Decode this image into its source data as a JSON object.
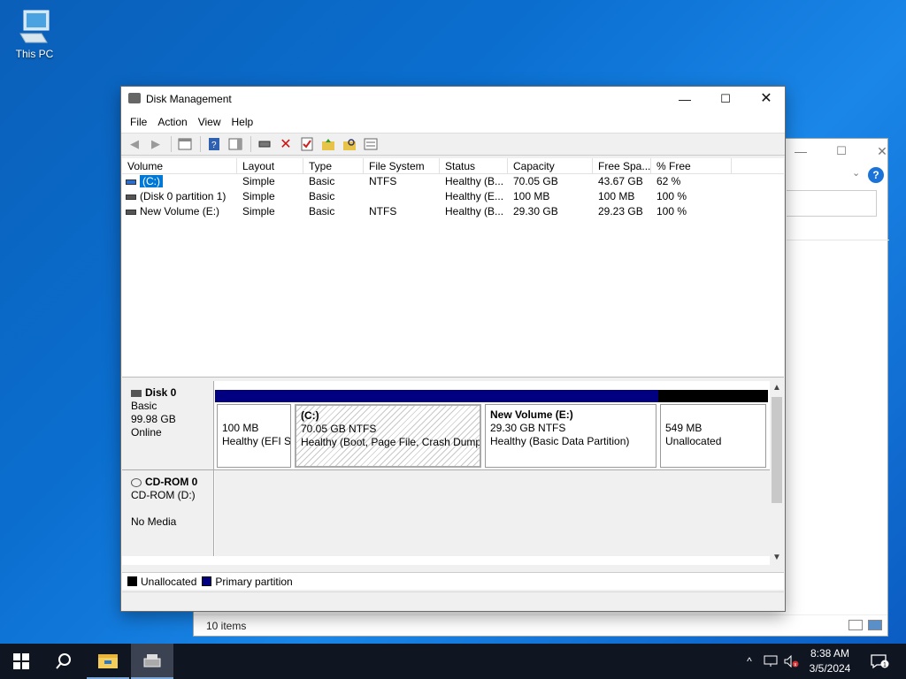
{
  "desktop": {
    "icon_label": "This PC"
  },
  "bg_window": {
    "status_text": "10 items"
  },
  "window": {
    "title": "Disk Management",
    "menu": [
      "File",
      "Action",
      "View",
      "Help"
    ],
    "columns": [
      "Volume",
      "Layout",
      "Type",
      "File System",
      "Status",
      "Capacity",
      "Free Spa...",
      "% Free"
    ],
    "volumes": [
      {
        "volume": "(C:)",
        "layout": "Simple",
        "type": "Basic",
        "fs": "NTFS",
        "status": "Healthy (B...",
        "capacity": "70.05 GB",
        "free": "43.67 GB",
        "pct": "62 %"
      },
      {
        "volume": "(Disk 0 partition 1)",
        "layout": "Simple",
        "type": "Basic",
        "fs": "",
        "status": "Healthy (E...",
        "capacity": "100 MB",
        "free": "100 MB",
        "pct": "100 %"
      },
      {
        "volume": "New Volume (E:)",
        "layout": "Simple",
        "type": "Basic",
        "fs": "NTFS",
        "status": "Healthy (B...",
        "capacity": "29.30 GB",
        "free": "29.23 GB",
        "pct": "100 %"
      }
    ],
    "disk0": {
      "name": "Disk 0",
      "type": "Basic",
      "size": "99.98 GB",
      "state": "Online",
      "partitions": [
        {
          "title": "",
          "line1": "100 MB",
          "line2": "Healthy (EFI S"
        },
        {
          "title": "(C:)",
          "line1": "70.05 GB NTFS",
          "line2": "Healthy (Boot, Page File, Crash Dump,"
        },
        {
          "title": "New Volume  (E:)",
          "line1": "29.30 GB NTFS",
          "line2": "Healthy (Basic Data Partition)"
        },
        {
          "title": "",
          "line1": "549 MB",
          "line2": "Unallocated"
        }
      ]
    },
    "cdrom": {
      "name": "CD-ROM 0",
      "line1": "CD-ROM (D:)",
      "line2": "No Media"
    },
    "legend": {
      "unallocated": "Unallocated",
      "primary": "Primary partition"
    },
    "colors": {
      "primary": "#000080",
      "unallocated": "#000000",
      "selection": "#0078d7"
    }
  },
  "taskbar": {
    "time": "8:38 AM",
    "date": "3/5/2024"
  }
}
